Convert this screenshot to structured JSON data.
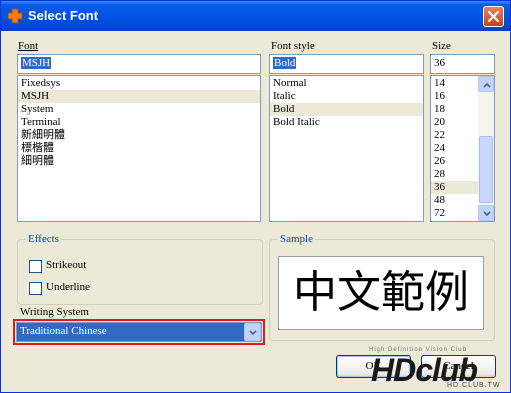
{
  "window": {
    "title": "Select Font"
  },
  "font": {
    "label": "Font",
    "value": "MSJH",
    "items": [
      "Fixedsys",
      "MSJH",
      "System",
      "Terminal",
      "新細明體",
      "標楷體",
      "細明體"
    ],
    "selected_index": 1
  },
  "style": {
    "label": "Font style",
    "value": "Bold",
    "items": [
      "Normal",
      "Italic",
      "Bold",
      "Bold Italic"
    ],
    "selected_index": 2
  },
  "size": {
    "label": "Size",
    "value": "36",
    "items": [
      "14",
      "16",
      "18",
      "20",
      "22",
      "24",
      "26",
      "28",
      "36",
      "48",
      "72"
    ],
    "selected_index": 8
  },
  "effects": {
    "title": "Effects",
    "strikeout": {
      "label": "Strikeout",
      "checked": false
    },
    "underline": {
      "label": "Underline",
      "checked": false
    }
  },
  "sample": {
    "title": "Sample",
    "text": "中文範例"
  },
  "writing_system": {
    "label": "Writing System",
    "value": "Traditional Chinese"
  },
  "buttons": {
    "ok": "OK",
    "cancel": "Cancel"
  },
  "watermark": {
    "tagline": "High Definition Vision Club",
    "brand": "HDclub",
    "url": "HD.CLUB.TW"
  },
  "icons": {
    "app": "puzzle-icon",
    "close": "close-icon"
  }
}
